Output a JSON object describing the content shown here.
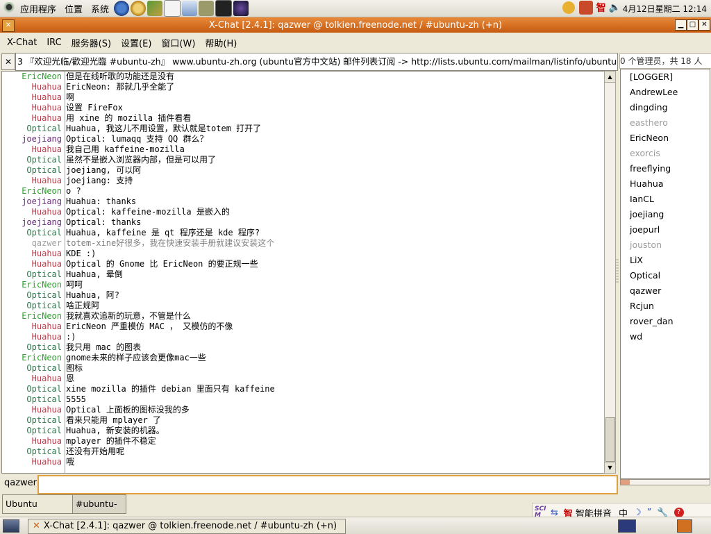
{
  "top_panel": {
    "menus": [
      "应用程序",
      "位置",
      "系统"
    ],
    "clock": "4月12日星期二 12:14"
  },
  "window": {
    "title": "X-Chat [2.4.1]: qazwer @ tolkien.freenode.net / #ubuntu-zh (+n)",
    "menus": [
      "X-Chat",
      "IRC",
      "服务器(S)",
      "设置(E)",
      "窗口(W)",
      "帮助(H)"
    ]
  },
  "topic": "3 『欢迎光临/歡迎光臨 #ubuntu-zh』  www.ubuntu-zh.org (ubuntu官方中文站) 邮件列表订阅 -> http://lists.ubuntu.com/mailman/listinfo/ubuntu-zh",
  "user_count": "0 个管理员，共 18 人",
  "messages": [
    {
      "nick": "EricNeon",
      "color": "eric",
      "text": "但是在线听歌的功能还是没有"
    },
    {
      "nick": "Huahua",
      "color": "huahua",
      "text": "EricNeon: 那就几乎全能了"
    },
    {
      "nick": "Huahua",
      "color": "huahua",
      "text": "啊"
    },
    {
      "nick": "Huahua",
      "color": "huahua",
      "text": "设置 FireFox"
    },
    {
      "nick": "Huahua",
      "color": "huahua",
      "text": "用 xine 的 mozilla 插件看看"
    },
    {
      "nick": "Optical",
      "color": "optical",
      "text": "Huahua, 我这儿不用设置，默认就是totem 打开了"
    },
    {
      "nick": "joejiang",
      "color": "joe",
      "text": "Optical: lumaqq 支持 QQ 群么？"
    },
    {
      "nick": "Huahua",
      "color": "huahua",
      "text": "我自己用 kaffeine-mozilla"
    },
    {
      "nick": "Optical",
      "color": "optical",
      "text": "虽然不是嵌入浏览器内部，但是可以用了"
    },
    {
      "nick": "Optical",
      "color": "optical",
      "text": "joejiang, 可以阿"
    },
    {
      "nick": "Huahua",
      "color": "huahua",
      "text": "joejiang: 支持"
    },
    {
      "nick": "EricNeon",
      "color": "eric",
      "text": "o ?"
    },
    {
      "nick": "joejiang",
      "color": "joe",
      "text": "Huahua: thanks"
    },
    {
      "nick": "Huahua",
      "color": "huahua",
      "text": "Optical:  kaffeine-mozilla 是嵌入的"
    },
    {
      "nick": "joejiang",
      "color": "joe",
      "text": "Optical: thanks"
    },
    {
      "nick": "Optical",
      "color": "optical",
      "text": "Huahua, kaffeine 是 qt 程序还是 kde 程序?"
    },
    {
      "nick": "qazwer",
      "color": "qazwer",
      "text": "totem-xine好很多，我在快速安装手册就建议安装这个"
    },
    {
      "nick": "Huahua",
      "color": "huahua",
      "text": "KDE :)"
    },
    {
      "nick": "Huahua",
      "color": "huahua",
      "text": "Optical 的 Gnome 比 EricNeon 的要正规一些"
    },
    {
      "nick": "Optical",
      "color": "optical",
      "text": "Huahua, 晕倒"
    },
    {
      "nick": "EricNeon",
      "color": "eric",
      "text": "呵呵"
    },
    {
      "nick": "Optical",
      "color": "optical",
      "text": "Huahua, 阿?"
    },
    {
      "nick": "Optical",
      "color": "optical",
      "text": "啥正规阿"
    },
    {
      "nick": "EricNeon",
      "color": "eric",
      "text": "我就喜欢追新的玩意，不管是什么"
    },
    {
      "nick": "Huahua",
      "color": "huahua",
      "text": " EricNeon 严重模仿 MAC ， 又模仿的不像"
    },
    {
      "nick": "Huahua",
      "color": "huahua",
      "text": ":)"
    },
    {
      "nick": "Optical",
      "color": "optical",
      "text": "我只用 mac 的图表"
    },
    {
      "nick": "EricNeon",
      "color": "eric",
      "text": "gnome未来的样子应该会更像mac一些"
    },
    {
      "nick": "Optical",
      "color": "optical",
      "text": "图标"
    },
    {
      "nick": "Huahua",
      "color": "huahua",
      "text": "恩"
    },
    {
      "nick": "Optical",
      "color": "optical",
      "text": "xine mozilla 的插件 debian 里面只有 kaffeine"
    },
    {
      "nick": "Optical",
      "color": "optical",
      "text": "5555"
    },
    {
      "nick": "Huahua",
      "color": "huahua",
      "text": "Optical 上面板的图标没我的多"
    },
    {
      "nick": "Optical",
      "color": "optical",
      "text": "看来只能用 mplayer 了"
    },
    {
      "nick": "Optical",
      "color": "optical",
      "text": "Huahua, 新安装的机器。"
    },
    {
      "nick": "Huahua",
      "color": "huahua",
      "text": "mplayer 的插件不稳定"
    },
    {
      "nick": "Optical",
      "color": "optical",
      "text": "还没有开始用呢"
    },
    {
      "nick": "Huahua",
      "color": "huahua",
      "text": "哦"
    }
  ],
  "users": [
    {
      "name": "[LOGGER]",
      "away": false
    },
    {
      "name": "AndrewLee",
      "away": false
    },
    {
      "name": "dingding",
      "away": false
    },
    {
      "name": "easthero",
      "away": true
    },
    {
      "name": "EricNeon",
      "away": false
    },
    {
      "name": "exorcis",
      "away": true
    },
    {
      "name": "freeflying",
      "away": false
    },
    {
      "name": "Huahua",
      "away": false
    },
    {
      "name": "IanCL",
      "away": false
    },
    {
      "name": "joejiang",
      "away": false
    },
    {
      "name": "joepurl",
      "away": false
    },
    {
      "name": "jouston",
      "away": true
    },
    {
      "name": "LiX",
      "away": false
    },
    {
      "name": "Optical",
      "away": false
    },
    {
      "name": "qazwer",
      "away": false
    },
    {
      "name": "Rcjun",
      "away": false
    },
    {
      "name": "rover_dan",
      "away": false
    },
    {
      "name": "wd",
      "away": false
    }
  ],
  "input": {
    "nick": "qazwer",
    "value": ""
  },
  "channel_tabs": [
    "Ubuntu Servers",
    "#ubuntu-zh"
  ],
  "ime": {
    "name": "智能拼音",
    "mode": "中",
    "logo": "SCIM"
  },
  "taskbar": {
    "task": "X-Chat [2.4.1]: qazwer @ tolkien.freenode.net / #ubuntu-zh (+n)"
  },
  "colors": {
    "titlebar": "#d9701e",
    "accent": "#e0a040"
  }
}
